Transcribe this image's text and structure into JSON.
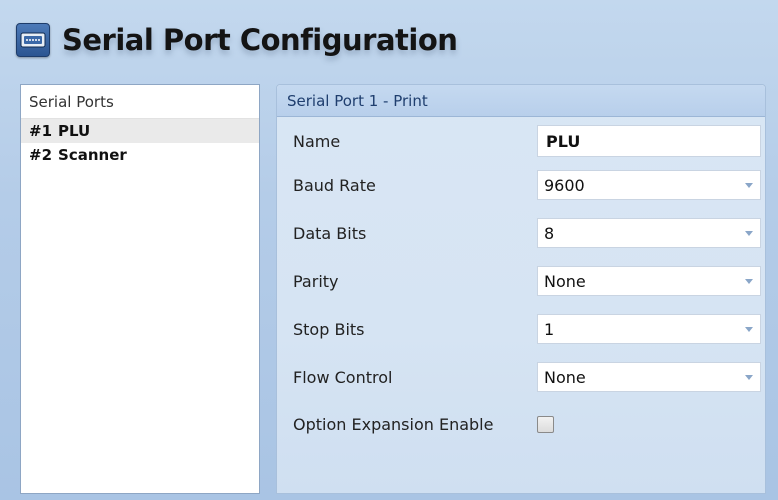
{
  "window": {
    "title": "Serial Port Configuration",
    "icon": "serial-port-icon"
  },
  "ports": {
    "header": "Serial Ports",
    "items": [
      {
        "number": "#1",
        "name": "PLU",
        "selected": true
      },
      {
        "number": "#2",
        "name": "Scanner",
        "selected": false
      }
    ]
  },
  "config": {
    "header": "Serial Port 1 - Print",
    "name": {
      "label": "Name",
      "value": "PLU"
    },
    "baud_rate": {
      "label": "Baud Rate",
      "value": "9600"
    },
    "data_bits": {
      "label": "Data Bits",
      "value": "8"
    },
    "parity": {
      "label": "Parity",
      "value": "None"
    },
    "stop_bits": {
      "label": "Stop Bits",
      "value": "1"
    },
    "flow_control": {
      "label": "Flow Control",
      "value": "None"
    },
    "option_expansion": {
      "label": "Option Expansion Enable",
      "checked": false
    }
  },
  "colors": {
    "background": "#b4cce8",
    "panel_header": "#c5d9f0",
    "header_text": "#1f3e6e",
    "dropdown_arrow": "#8aa6c8"
  }
}
